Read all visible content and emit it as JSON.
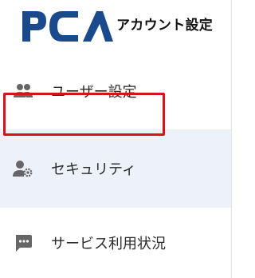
{
  "header": {
    "logo_text": "PCA",
    "title": "アカウント設定"
  },
  "nav": {
    "items": [
      {
        "label": "ユーザー設定",
        "icon": "users-icon"
      },
      {
        "label": "セキュリティ",
        "icon": "user-security-icon",
        "active": true
      },
      {
        "label": "サービス利用状況",
        "icon": "chat-icon"
      }
    ]
  },
  "colors": {
    "brand": "#1b4a8c",
    "active_bg": "#edf1fa",
    "highlight": "#d4141c",
    "icon": "#666666"
  }
}
